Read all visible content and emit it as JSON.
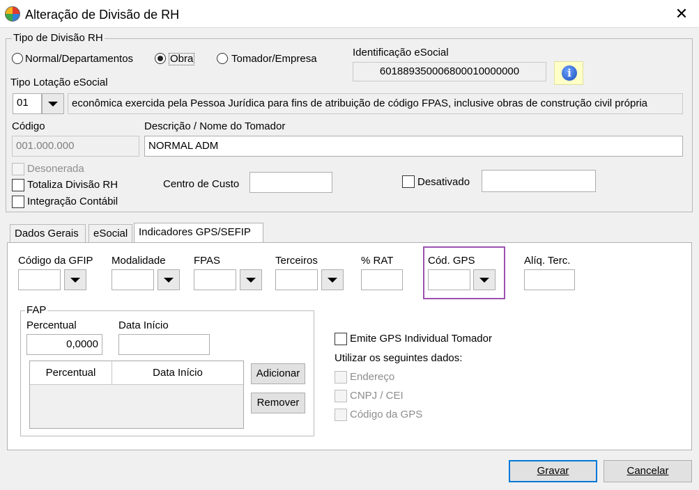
{
  "window": {
    "title": "Alteração de Divisão de RH",
    "close_symbol": "✕"
  },
  "tipo_divisao": {
    "group_title": "Tipo de Divisão RH",
    "options": [
      "Normal/Departamentos",
      "Obra",
      "Tomador/Empresa"
    ],
    "selected": "Obra"
  },
  "identificacao": {
    "label": "Identificação eSocial",
    "value": "601889350006800010000000"
  },
  "lotacao": {
    "label": "Tipo Lotação eSocial",
    "code": "01",
    "description": "econômica exercida pela Pessoa Jurídica para fins de atribuição de código FPAS, inclusive obras de construção civil própria"
  },
  "codigo": {
    "label": "Código",
    "value": "001.000.000"
  },
  "descricao": {
    "label": "Descrição / Nome do Tomador",
    "value": "NORMAL ADM"
  },
  "checks": {
    "desonerada": "Desonerada",
    "totaliza": "Totaliza Divisão RH",
    "integracao": "Integração Contábil",
    "desativado": "Desativado"
  },
  "centro_custo": {
    "label": "Centro de Custo",
    "value": ""
  },
  "desativado_value": "",
  "tabs": [
    "Dados Gerais",
    "eSocial",
    "Indicadores GPS/SEFIP"
  ],
  "active_tab": "Indicadores GPS/SEFIP",
  "gps_fields": {
    "codigo_gfip": "Código da GFIP",
    "modalidade": "Modalidade",
    "fpas": "FPAS",
    "terceiros": "Terceiros",
    "rat": "% RAT",
    "cod_gps": "Cód. GPS",
    "aliq_terc": "Alíq. Terc."
  },
  "fap": {
    "group_title": "FAP",
    "percentual_label": "Percentual",
    "percentual_value": "0,0000",
    "data_inicio_label": "Data Início",
    "data_inicio_value": "",
    "grid_headers": [
      "Percentual",
      "Data Início"
    ],
    "add_button": "Adicionar",
    "remove_button": "Remover"
  },
  "emite": {
    "label": "Emite GPS Individual Tomador",
    "utilizar_label": "Utilizar os seguintes dados:",
    "endereco": "Endereço",
    "cnpj": "CNPJ / CEI",
    "codigo_gps": "Código da GPS"
  },
  "footer": {
    "gravar": "Gravar",
    "cancelar": "Cancelar"
  },
  "colors": {
    "highlight": "#9b51b0",
    "default_button_border": "#0078d7"
  }
}
